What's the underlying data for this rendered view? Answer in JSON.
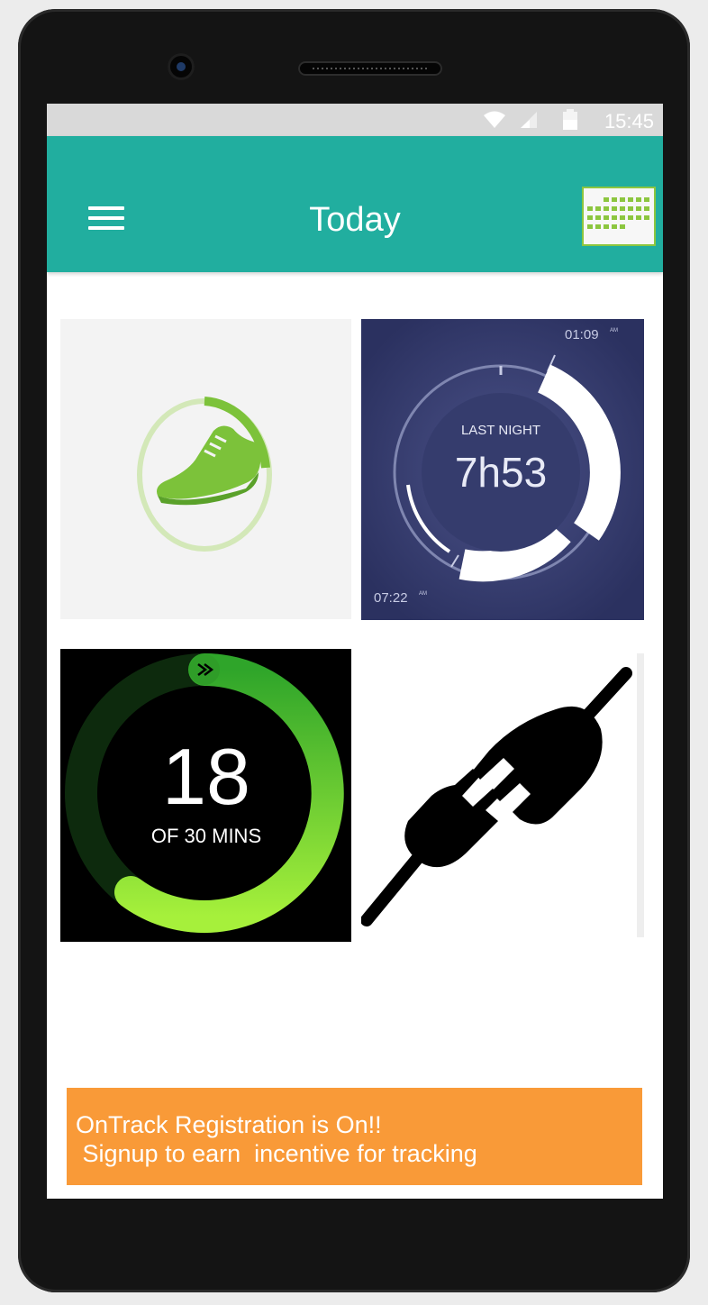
{
  "status_bar": {
    "time": "15:45",
    "icons": [
      "wifi-icon",
      "cell-signal-icon",
      "battery-icon"
    ]
  },
  "app_bar": {
    "title": "Today",
    "menu_icon": "hamburger-menu-icon",
    "calendar_icon": "calendar-icon",
    "color": "#21ae9f"
  },
  "tiles": {
    "steps": {
      "icon": "running-shoe-icon",
      "ring_accent": "#8cc63f"
    },
    "sleep": {
      "label": "LAST NIGHT",
      "duration": "7h53",
      "start_time": "01:09",
      "start_ampm": "AM",
      "end_time": "07:22",
      "end_ampm": "AM"
    },
    "activity": {
      "value": "18",
      "label": "OF 30 MINS",
      "progress": 0.6
    },
    "disconnect": {
      "icon": "unplugged-icon"
    }
  },
  "banner": {
    "line1": "OnTrack Registration is On!!",
    "line2": " Signup to earn  incentive for tracking",
    "color": "#f99a38"
  }
}
